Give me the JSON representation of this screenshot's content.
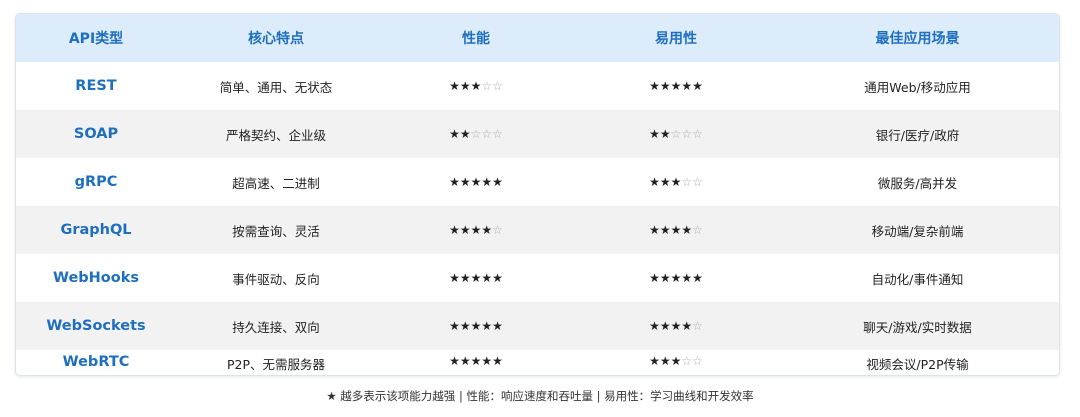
{
  "headers": [
    "API类型",
    "核心特点",
    "性能",
    "易用性",
    "最佳应用场景"
  ],
  "rows": [
    {
      "name": "REST",
      "feature": "简单、通用、无状态",
      "performance": 3,
      "usability": 5,
      "scenario": "通用Web/移动应用"
    },
    {
      "name": "SOAP",
      "feature": "严格契约、企业级",
      "performance": 2,
      "usability": 2,
      "scenario": "银行/医疗/政府"
    },
    {
      "name": "gRPC",
      "feature": "超高速、二进制",
      "performance": 5,
      "usability": 3,
      "scenario": "微服务/高并发"
    },
    {
      "name": "GraphQL",
      "feature": "按需查询、灵活",
      "performance": 4,
      "usability": 4,
      "scenario": "移动端/复杂前端"
    },
    {
      "name": "WebHooks",
      "feature": "事件驱动、反向",
      "performance": 5,
      "usability": 5,
      "scenario": "自动化/事件通知"
    },
    {
      "name": "WebSockets",
      "feature": "持久连接、双向",
      "performance": 5,
      "usability": 4,
      "scenario": "聊天/游戏/实时数据"
    },
    {
      "name": "WebRTC",
      "feature": "P2P、无需服务器",
      "performance": 5,
      "usability": 3,
      "scenario": "视频会议/P2P传输"
    }
  ],
  "rating_max": 5,
  "footnote": "★ 越多表示该项能力越强 | 性能：响应速度和吞吐量 | 易用性：学习曲线和开发效率"
}
